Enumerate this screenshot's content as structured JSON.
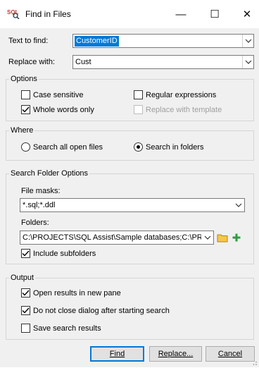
{
  "window": {
    "title": "Find in Files",
    "app_icon": "sql-app-icon"
  },
  "window_controls": {
    "minimize": "—",
    "maximize": "☐",
    "close": "✕"
  },
  "find": {
    "label": "Text to find:",
    "value": "CustomerID"
  },
  "replace": {
    "label": "Replace with:",
    "value": "Cust"
  },
  "options": {
    "legend": "Options",
    "case_sensitive": {
      "label": "Case sensitive",
      "checked": false
    },
    "regular_expressions": {
      "label": "Regular expressions",
      "checked": false
    },
    "whole_words": {
      "label": "Whole words only",
      "checked": true
    },
    "replace_template": {
      "label": "Replace with template",
      "checked": false,
      "disabled": true
    }
  },
  "where": {
    "legend": "Where",
    "all_open_files": {
      "label": "Search all open files",
      "selected": false
    },
    "in_folders": {
      "label": "Search in folders",
      "selected": true
    }
  },
  "folder_options": {
    "legend": "Search Folder Options",
    "file_masks_label": "File masks:",
    "file_masks_value": "*.sql;*.ddl",
    "folders_label": "Folders:",
    "folders_value": "C:\\PROJECTS\\SQL Assist\\Sample databases;C:\\PRC",
    "include_subfolders": {
      "label": "Include subfolders",
      "checked": true
    },
    "browse_icon": "folder-icon",
    "add_icon": "plus-icon"
  },
  "output": {
    "legend": "Output",
    "new_pane": {
      "label": "Open results in new pane",
      "checked": true
    },
    "dont_close": {
      "label": "Do not close dialog after starting search",
      "checked": true
    },
    "save_results": {
      "label": "Save search results",
      "checked": false
    }
  },
  "buttons": {
    "find": "Find",
    "replace": "Replace...",
    "cancel": "Cancel"
  },
  "colors": {
    "selection": "#0078d7",
    "folder": "#f2c94c",
    "plus": "#2e9e3e"
  }
}
